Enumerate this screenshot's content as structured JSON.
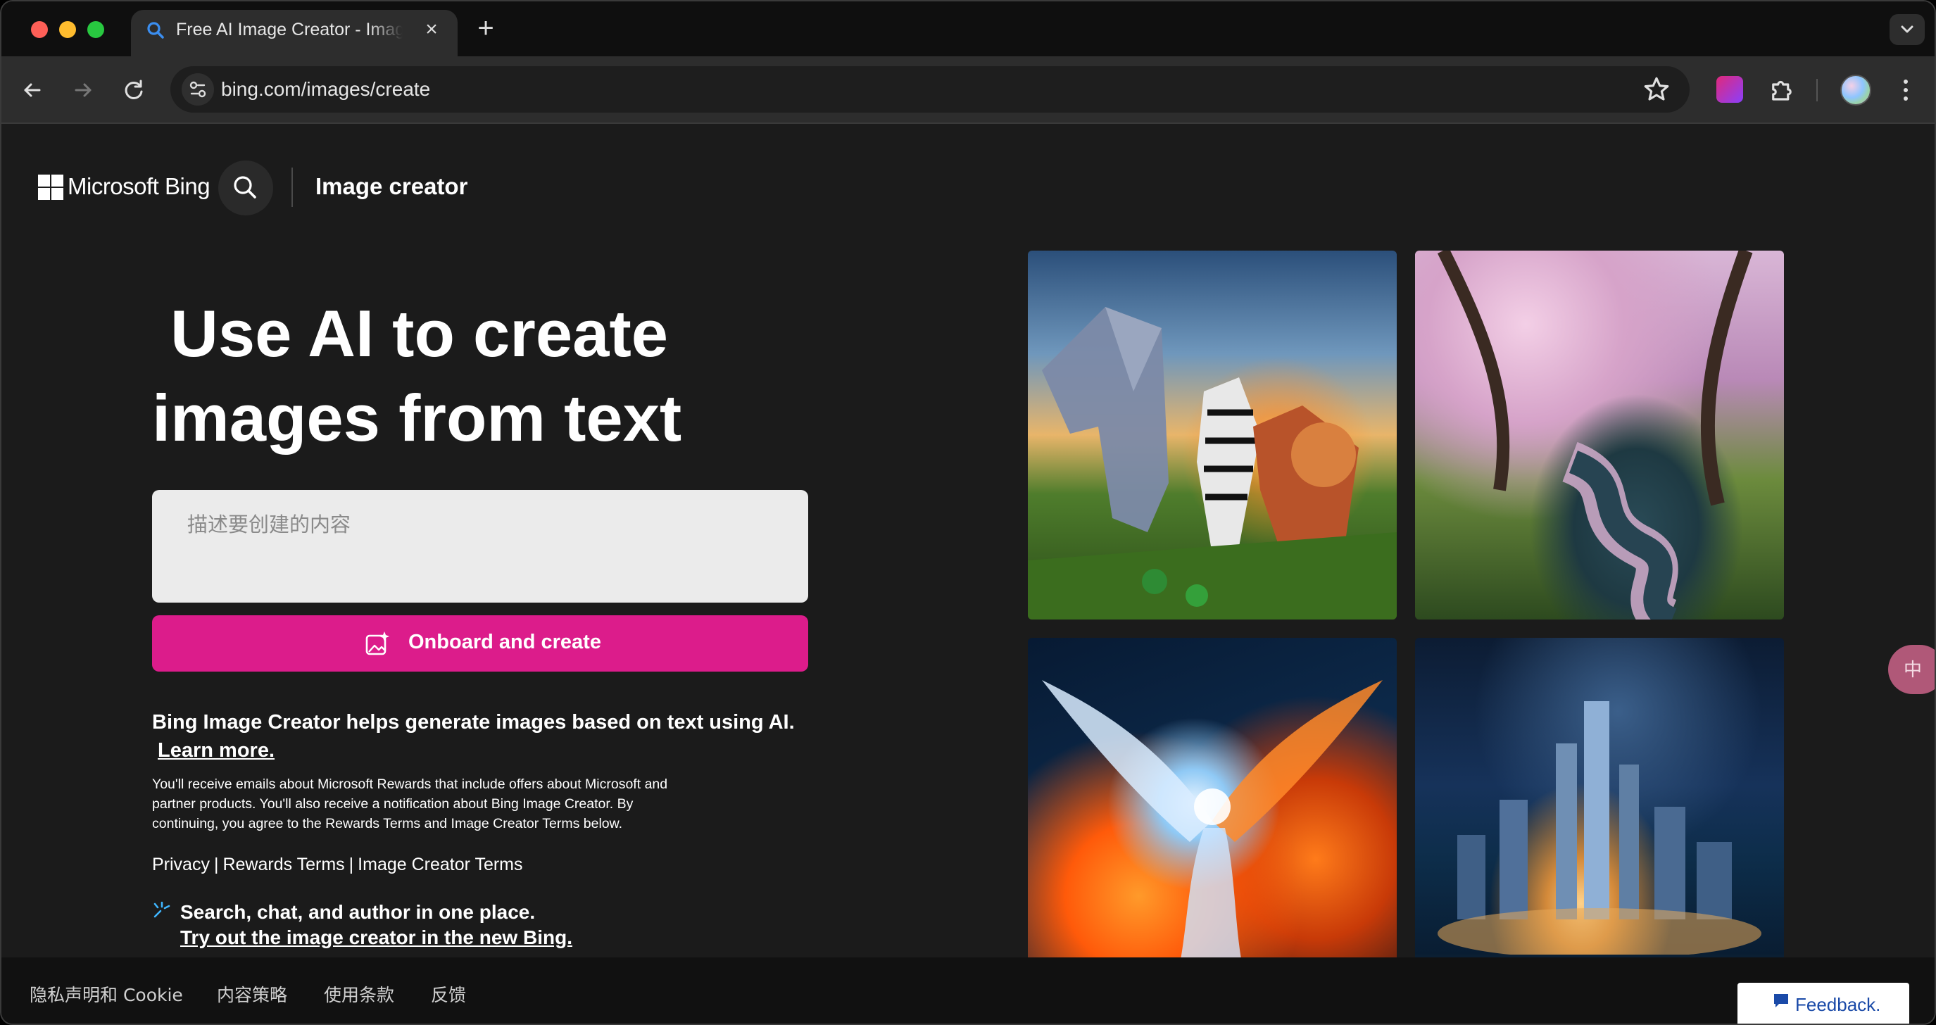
{
  "browser": {
    "tab_title": "Free AI Image Creator - Image Creator",
    "url": "bing.com/images/create"
  },
  "header": {
    "brand": "Microsoft Bing",
    "product": "Image creator"
  },
  "hero": {
    "line1": "Use AI to create",
    "line2": "images from text"
  },
  "prompt": {
    "placeholder": "描述要创建的内容"
  },
  "create_button": {
    "label": "Onboard and create"
  },
  "info": {
    "bold_text": "Bing Image Creator helps generate images based on text using AI.",
    "learn_more": "Learn more.",
    "fine_print": "You'll receive emails about Microsoft Rewards that include offers about Microsoft and partner products. You'll also receive a notification about Bing Image Creator. By continuing, you agree to the Rewards Terms and Image Creator Terms below."
  },
  "legal_links": {
    "privacy": "Privacy",
    "rewards_terms": "Rewards Terms",
    "creator_terms": "Image Creator Terms",
    "separator": "|"
  },
  "new_bing": {
    "text": "Search, chat, and author in one place.",
    "link": "Try out the image creator in the new Bing."
  },
  "footer": {
    "privacy_cookie": "隐私声明和 Cookie",
    "content_policy": "内容策略",
    "terms_of_use": "使用条款",
    "feedback": "反馈",
    "feedback_button": "Feedback."
  },
  "colors": {
    "accent_pink": "#dc1c8b",
    "page_bg": "#1b1b1b",
    "input_bg": "#ebebeb"
  },
  "icons": [
    "search-icon",
    "back-icon",
    "forward-icon",
    "reload-icon",
    "star-icon",
    "puzzle-icon",
    "menu-icon",
    "image-sparkle-icon",
    "translate-icon",
    "feedback-icon"
  ]
}
